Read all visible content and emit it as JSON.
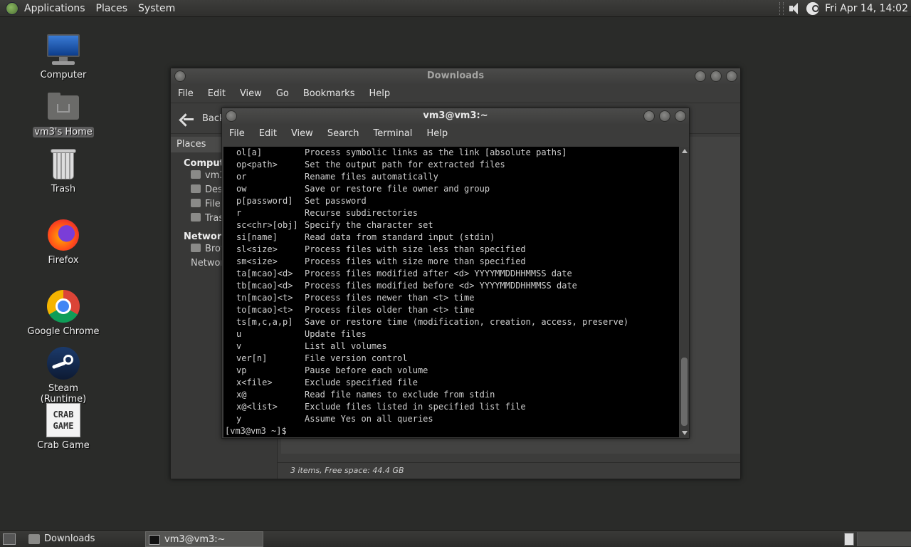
{
  "top_panel": {
    "menus": [
      "Applications",
      "Places",
      "System"
    ],
    "clock": "Fri Apr 14, 14:02"
  },
  "desktop_icons": [
    {
      "label": "Computer"
    },
    {
      "label": "vm3's Home"
    },
    {
      "label": "Trash"
    },
    {
      "label": "Firefox"
    },
    {
      "label": "Google Chrome"
    },
    {
      "label": "Steam (Runtime)"
    },
    {
      "label": "Crab Game"
    }
  ],
  "crab_logo": "CRAB\nGAME",
  "file_manager": {
    "title": "Downloads",
    "menus": [
      "File",
      "Edit",
      "View",
      "Go",
      "Bookmarks",
      "Help"
    ],
    "back_label": "Back",
    "sidebar_header": "Places",
    "computer_group": "Computer",
    "computer_items": [
      "vm3",
      "Desktop",
      "File System",
      "Trash"
    ],
    "network_group": "Network",
    "network_items": [
      "Browse Network"
    ],
    "status": "3 items, Free space: 44.4 GB"
  },
  "terminal": {
    "title": "vm3@vm3:~",
    "menus": [
      "File",
      "Edit",
      "View",
      "Search",
      "Terminal",
      "Help"
    ],
    "lines": [
      {
        "opt": "ol[a]",
        "desc": "Process symbolic links as the link [absolute paths]"
      },
      {
        "opt": "op<path>",
        "desc": "Set the output path for extracted files"
      },
      {
        "opt": "or",
        "desc": "Rename files automatically"
      },
      {
        "opt": "ow",
        "desc": "Save or restore file owner and group"
      },
      {
        "opt": "p[password]",
        "desc": "Set password"
      },
      {
        "opt": "r",
        "desc": "Recurse subdirectories"
      },
      {
        "opt": "sc<chr>[obj]",
        "desc": "Specify the character set"
      },
      {
        "opt": "si[name]",
        "desc": "Read data from standard input (stdin)"
      },
      {
        "opt": "sl<size>",
        "desc": "Process files with size less than specified"
      },
      {
        "opt": "sm<size>",
        "desc": "Process files with size more than specified"
      },
      {
        "opt": "ta[mcao]<d>",
        "desc": "Process files modified after <d> YYYYMMDDHHMMSS date"
      },
      {
        "opt": "tb[mcao]<d>",
        "desc": "Process files modified before <d> YYYYMMDDHHMMSS date"
      },
      {
        "opt": "tn[mcao]<t>",
        "desc": "Process files newer than <t> time"
      },
      {
        "opt": "to[mcao]<t>",
        "desc": "Process files older than <t> time"
      },
      {
        "opt": "ts[m,c,a,p]",
        "desc": "Save or restore time (modification, creation, access, preserve)"
      },
      {
        "opt": "u",
        "desc": "Update files"
      },
      {
        "opt": "v",
        "desc": "List all volumes"
      },
      {
        "opt": "ver[n]",
        "desc": "File version control"
      },
      {
        "opt": "vp",
        "desc": "Pause before each volume"
      },
      {
        "opt": "x<file>",
        "desc": "Exclude specified file"
      },
      {
        "opt": "x@",
        "desc": "Read file names to exclude from stdin"
      },
      {
        "opt": "x@<list>",
        "desc": "Exclude files listed in specified list file"
      },
      {
        "opt": "y",
        "desc": "Assume Yes on all queries"
      }
    ],
    "prompt": "[vm3@vm3 ~]$ "
  },
  "taskbar": {
    "tasks": [
      "Downloads",
      "vm3@vm3:~"
    ]
  }
}
